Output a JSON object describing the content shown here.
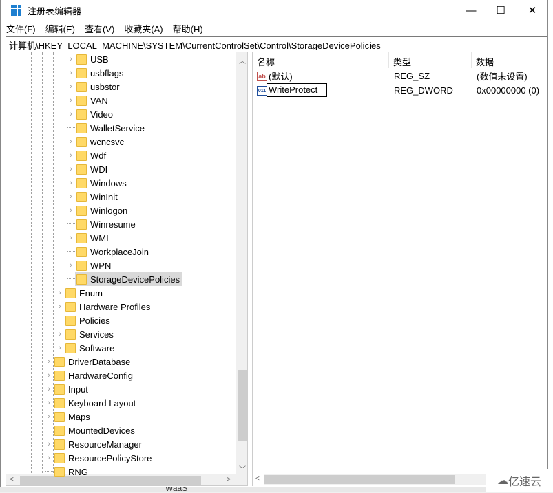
{
  "window": {
    "title": "注册表编辑器",
    "minimize": "—",
    "maximize": "☐",
    "close": "✕"
  },
  "menu": [
    "文件(F)",
    "编辑(E)",
    "查看(V)",
    "收藏夹(A)",
    "帮助(H)"
  ],
  "address": "计算机\\HKEY_LOCAL_MACHINE\\SYSTEM\\CurrentControlSet\\Control\\StorageDevicePolicies",
  "tree": [
    {
      "label": "USB",
      "level": 3,
      "expandable": true
    },
    {
      "label": "usbflags",
      "level": 3,
      "expandable": true
    },
    {
      "label": "usbstor",
      "level": 3,
      "expandable": true
    },
    {
      "label": "VAN",
      "level": 3,
      "expandable": true
    },
    {
      "label": "Video",
      "level": 3,
      "expandable": true
    },
    {
      "label": "WalletService",
      "level": 3,
      "expandable": false
    },
    {
      "label": "wcncsvc",
      "level": 3,
      "expandable": true
    },
    {
      "label": "Wdf",
      "level": 3,
      "expandable": true
    },
    {
      "label": "WDI",
      "level": 3,
      "expandable": true
    },
    {
      "label": "Windows",
      "level": 3,
      "expandable": true
    },
    {
      "label": "WinInit",
      "level": 3,
      "expandable": true
    },
    {
      "label": "Winlogon",
      "level": 3,
      "expandable": true
    },
    {
      "label": "Winresume",
      "level": 3,
      "expandable": false
    },
    {
      "label": "WMI",
      "level": 3,
      "expandable": true
    },
    {
      "label": "WorkplaceJoin",
      "level": 3,
      "expandable": false
    },
    {
      "label": "WPN",
      "level": 3,
      "expandable": true
    },
    {
      "label": "StorageDevicePolicies",
      "level": 3,
      "expandable": false,
      "selected": true
    },
    {
      "label": "Enum",
      "level": 2,
      "expandable": true
    },
    {
      "label": "Hardware Profiles",
      "level": 2,
      "expandable": true
    },
    {
      "label": "Policies",
      "level": 2,
      "expandable": false
    },
    {
      "label": "Services",
      "level": 2,
      "expandable": true
    },
    {
      "label": "Software",
      "level": 2,
      "expandable": true
    },
    {
      "label": "DriverDatabase",
      "level": 1,
      "expandable": true
    },
    {
      "label": "HardwareConfig",
      "level": 1,
      "expandable": true
    },
    {
      "label": "Input",
      "level": 1,
      "expandable": true
    },
    {
      "label": "Keyboard Layout",
      "level": 1,
      "expandable": true
    },
    {
      "label": "Maps",
      "level": 1,
      "expandable": true
    },
    {
      "label": "MountedDevices",
      "level": 1,
      "expandable": false
    },
    {
      "label": "ResourceManager",
      "level": 1,
      "expandable": true
    },
    {
      "label": "ResourcePolicyStore",
      "level": 1,
      "expandable": true
    },
    {
      "label": "RNG",
      "level": 1,
      "expandable": false
    }
  ],
  "list": {
    "headers": [
      "名称",
      "类型",
      "数据"
    ],
    "rows": [
      {
        "icon": "string-value-icon",
        "icon_text": "ab",
        "name": "(默认)",
        "type": "REG_SZ",
        "data": "(数值未设置)"
      },
      {
        "icon": "binary-value-icon",
        "icon_text": "011",
        "name": "WriteProtect",
        "type": "REG_DWORD",
        "data": "0x00000000 (0)",
        "editing": true
      }
    ]
  },
  "background_text": "WaaS",
  "watermark": "亿速云"
}
